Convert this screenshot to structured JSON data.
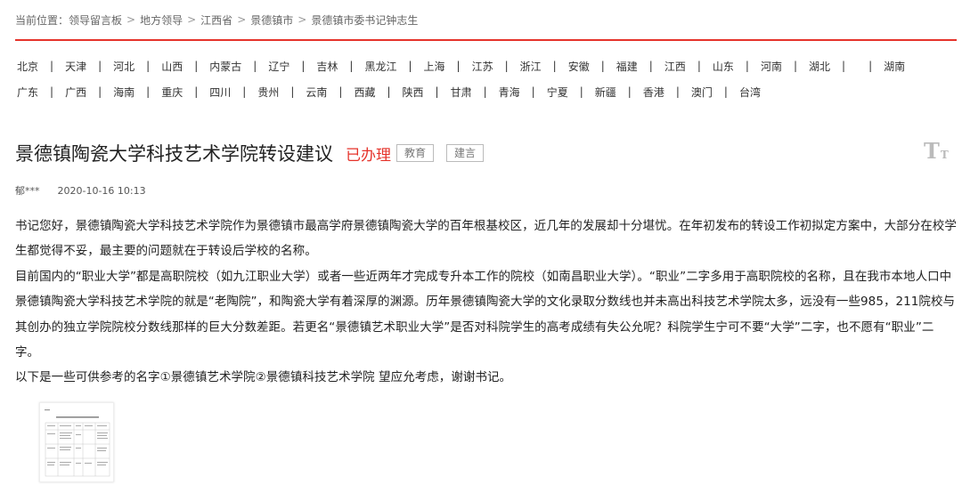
{
  "breadcrumb": {
    "prefix": "当前位置：",
    "items": [
      "领导留言板",
      "地方领导",
      "江西省",
      "景德镇市",
      "景德镇市委书记钟志生"
    ],
    "separator": ">"
  },
  "regions": {
    "row1": [
      "北京",
      "天津",
      "河北",
      "山西",
      "内蒙古",
      "辽宁",
      "吉林",
      "黑龙江",
      "上海",
      "江苏",
      "浙江",
      "安徽",
      "福建",
      "江西",
      "山东",
      "河南",
      "湖北",
      "湖南"
    ],
    "row2": [
      "广东",
      "广西",
      "海南",
      "重庆",
      "四川",
      "贵州",
      "云南",
      "西藏",
      "陕西",
      "甘肃",
      "青海",
      "宁夏",
      "新疆",
      "香港",
      "澳门",
      "台湾"
    ],
    "separator": "|"
  },
  "message": {
    "title": "景德镇陶瓷大学科技艺术学院转设建议",
    "status": "已办理",
    "tags": [
      "教育",
      "建言"
    ],
    "author": "郁***",
    "date": "2020-10-16 10:13",
    "paragraphs": [
      "书记您好，景德镇陶瓷大学科技艺术学院作为景德镇市最高学府景德镇陶瓷大学的百年根基校区，近几年的发展却十分堪忧。在年初发布的转设工作初拟定方案中，大部分在校学生都觉得不妥，最主要的问题就在于转设后学校的名称。",
      "目前国内的“职业大学”都是高职院校（如九江职业大学）或者一些近两年才完成专升本工作的院校（如南昌职业大学）。“职业”二字多用于高职院校的名称，且在我市本地人口中景德镇陶瓷大学科技艺术学院的就是“老陶院”，和陶瓷大学有着深厚的渊源。历年景德镇陶瓷大学的文化录取分数线也并未高出科技艺术学院太多，远没有一些985，211院校与其创办的独立学院院校分数线那样的巨大分数差距。若更名“景德镇艺术职业大学”是否对科院学生的高考成绩有失公允呢？科院学生宁可不要“大学”二字，也不愿有“职业”二字。",
      "以下是一些可供参考的名字①景德镇艺术学院②景德镇科技艺术学院 望应允考虑，谢谢书记。"
    ]
  },
  "font_toggle": {
    "big": "T",
    "small": "T"
  },
  "colors": {
    "accent": "#e5332b",
    "text": "#222222",
    "muted": "#666666"
  }
}
